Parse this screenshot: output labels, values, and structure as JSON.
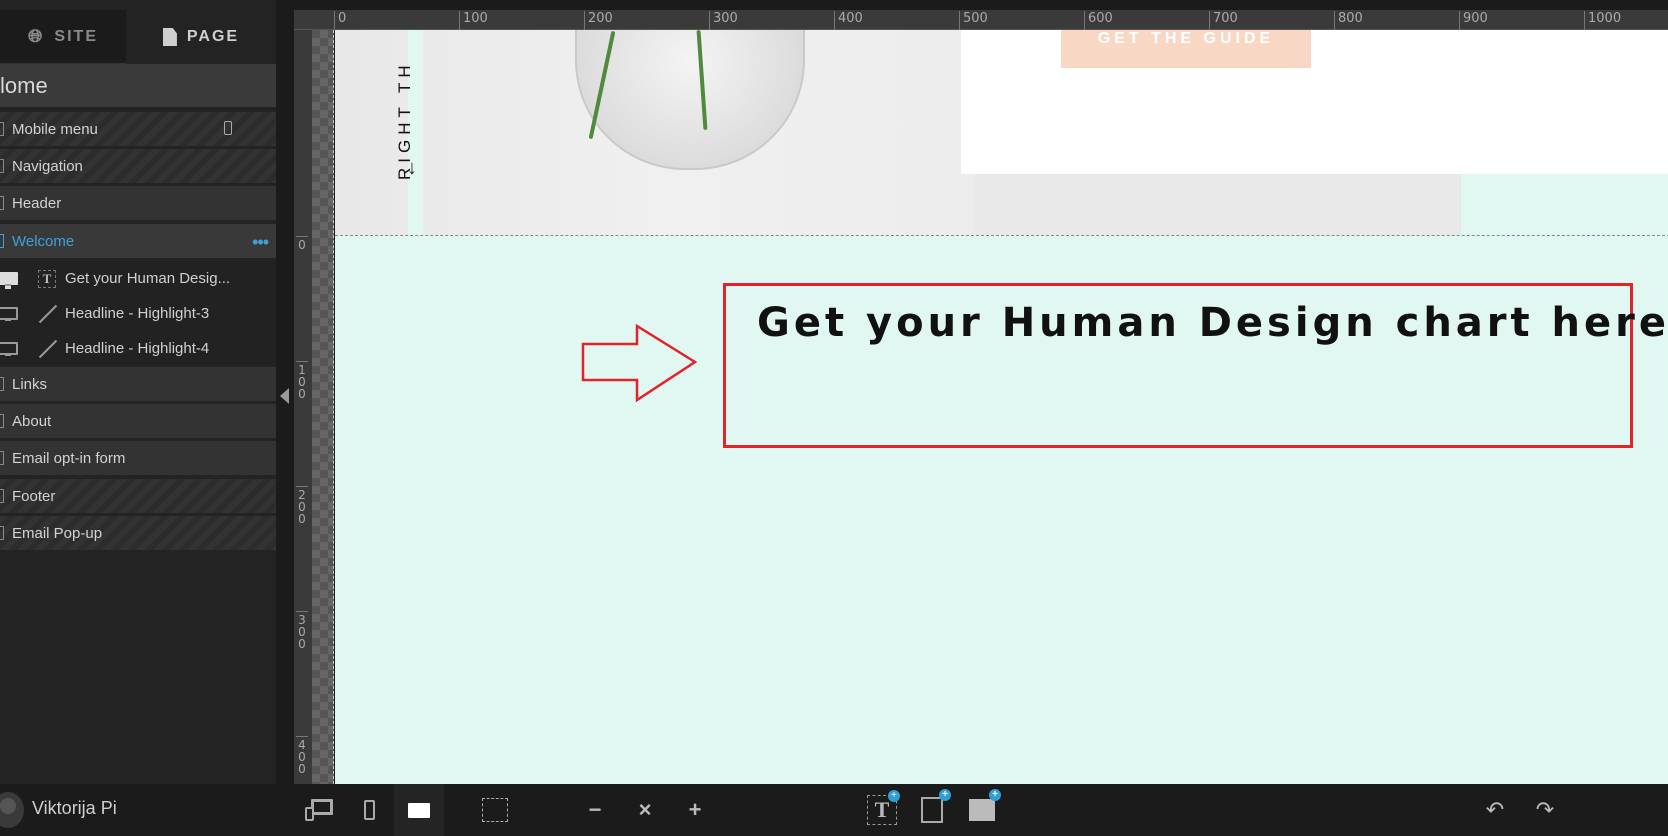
{
  "sidebar": {
    "tabs": [
      {
        "label": "SITE",
        "icon": "globe-icon"
      },
      {
        "label": "PAGE",
        "icon": "page-icon",
        "active": true
      }
    ],
    "page_name": "Home",
    "page_name_visible": "lome",
    "layers": [
      {
        "label": "Mobile menu",
        "striped": true,
        "icon": "mobile-icon"
      },
      {
        "label": "Navigation",
        "striped": true
      },
      {
        "label": "Header",
        "striped": false
      },
      {
        "label": "Welcome",
        "active": true,
        "more": "•••"
      },
      {
        "label": "Links",
        "striped": false
      },
      {
        "label": "About",
        "striped": false
      },
      {
        "label": "Email opt-in form",
        "striped": false
      },
      {
        "label": "Footer",
        "striped": true
      },
      {
        "label": "Email Pop-up",
        "striped": true
      }
    ],
    "welcome_children": [
      {
        "label": "Get your Human Desig...",
        "type_icon": "T"
      },
      {
        "label": "Headline - Highlight-3",
        "type_icon": "line"
      },
      {
        "label": "Headline - Highlight-4",
        "type_icon": "line"
      }
    ]
  },
  "ruler": {
    "top": [
      "0",
      "100",
      "200",
      "300",
      "400",
      "500",
      "600",
      "700",
      "800",
      "900",
      "1000"
    ],
    "left": [
      "0",
      "100",
      "200",
      "300",
      "400"
    ]
  },
  "canvas": {
    "vertical_text": "RIGHT TH",
    "down_arrow": "↓",
    "cta_label": "GET THE GUIDE",
    "headline": "Get your Human Design chart here",
    "annotation_color": "#e3222b",
    "section_bg": "#e1f7f2",
    "cta_bg": "#f8d7c4"
  },
  "bottombar": {
    "user_name": "Viktorija Pi",
    "view_modes": [
      "all-devices",
      "mobile",
      "desktop"
    ],
    "active_view": "desktop",
    "zoom_out": "−",
    "zoom_reset": "×",
    "zoom_in": "+",
    "add_text": "T",
    "add_box": "▢",
    "add_image": "🖼",
    "undo": "↶",
    "redo": "↷",
    "plus_badge": "+"
  }
}
